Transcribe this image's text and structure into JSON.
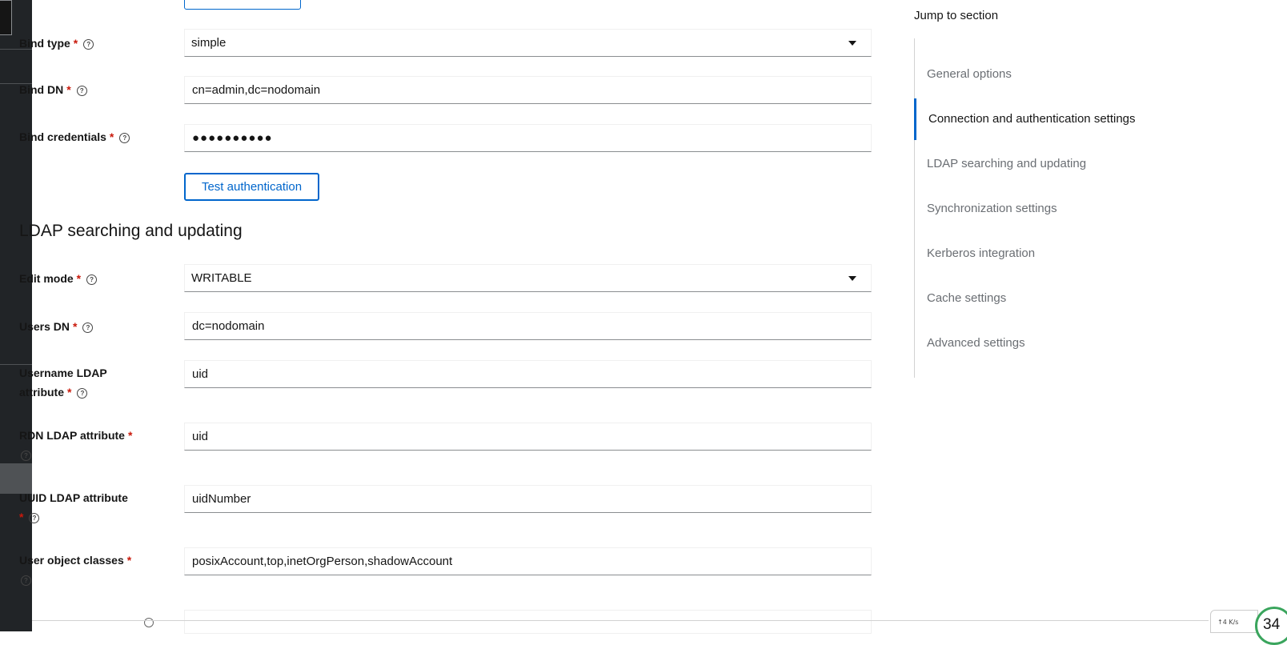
{
  "form": {
    "bind_type": {
      "label": "Bind type",
      "value": "simple"
    },
    "bind_dn": {
      "label": "Bind DN",
      "value": "cn=admin,dc=nodomain"
    },
    "bind_credentials": {
      "label": "Bind credentials",
      "value": "●●●●●●●●●●"
    },
    "test_auth_label": "Test authentication",
    "ldap_section_title": "LDAP searching and updating",
    "edit_mode": {
      "label": "Edit mode",
      "value": "WRITABLE"
    },
    "users_dn": {
      "label": "Users DN",
      "value": "dc=nodomain"
    },
    "username_attr": {
      "label_line1": "Username LDAP",
      "label_line2": "attribute",
      "value": "uid"
    },
    "rdn_attr": {
      "label": "RDN LDAP attribute",
      "value": "uid"
    },
    "uuid_attr": {
      "label": "UUID LDAP attribute",
      "value": "uidNumber"
    },
    "user_object_classes": {
      "label": "User object classes",
      "value": "posixAccount,top,inetOrgPerson,shadowAccount"
    },
    "required_mark": "*",
    "help_glyph": "?"
  },
  "jump": {
    "title": "Jump to section",
    "items": [
      {
        "label": "General options"
      },
      {
        "label": "Connection and authentication settings"
      },
      {
        "label": "LDAP searching and updating"
      },
      {
        "label": "Synchronization settings"
      },
      {
        "label": "Kerberos integration"
      },
      {
        "label": "Cache settings"
      },
      {
        "label": "Advanced settings"
      }
    ],
    "active_index": 1
  },
  "widget": {
    "net_text": "↑4  K/s",
    "gauge_text": "34"
  },
  "colors": {
    "accent": "#0066cc",
    "required": "#c9190b",
    "sidebar": "#212427"
  }
}
